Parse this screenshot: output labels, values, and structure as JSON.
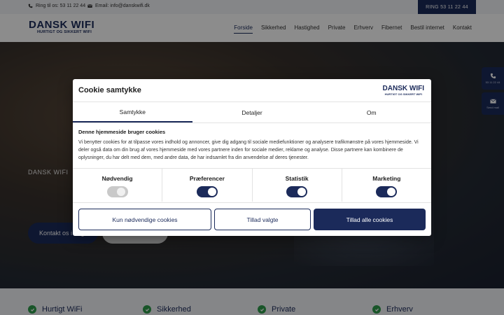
{
  "topbar": {
    "phone_text": "Ring til os: 53 11 22 44",
    "email_text": "Email: info@danskwifi.dk",
    "ring_button": "RING 53 11 22 44"
  },
  "logo": {
    "name": "DANSK WIFI",
    "tagline": "HURTIGT OG SIKKERT WIFI"
  },
  "nav": {
    "items": [
      "Forside",
      "Sikkerhed",
      "Hastighed",
      "Private",
      "Erhverv",
      "Fibernet",
      "Bestil internet",
      "Kontakt"
    ],
    "active": "Forside"
  },
  "hero": {
    "label": "DANSK WIFI",
    "button_contact": "Kontakt os i dag"
  },
  "side": {
    "phone_label": "53 11 22 44",
    "mail_label": "Send mail"
  },
  "features": [
    "Hurtigt WiFi",
    "Sikkerhed",
    "Private",
    "Erhverv"
  ],
  "cookie": {
    "title": "Cookie samtykke",
    "tabs": [
      "Samtykke",
      "Detaljer",
      "Om"
    ],
    "active_tab": "Samtykke",
    "content_title": "Denne hjemmeside bruger cookies",
    "content_body": "Vi benytter cookies for at tilpasse vores indhold og annoncer, give dig adgang til sociale mediefunktioner og analysere trafikmønstre på vores hjemmeside. Vi deler også data om din brug af vores hjemmeside med vores partnere inden for sociale medier, reklame og analyse. Disse partnere kan kombinere de oplysninger, du har delt med dem, med andre data, de har indsamlet fra din anvendelse af deres tjenester.",
    "toggles": [
      {
        "label": "Nødvendig",
        "on": false
      },
      {
        "label": "Præferencer",
        "on": true
      },
      {
        "label": "Statistik",
        "on": true
      },
      {
        "label": "Marketing",
        "on": true
      }
    ],
    "buttons": {
      "necessary": "Kun nødvendige cookies",
      "selected": "Tillad valgte",
      "all": "Tillad alle cookies"
    }
  },
  "colors": {
    "brand": "#1b2a5a",
    "check": "#2e9b4b"
  }
}
